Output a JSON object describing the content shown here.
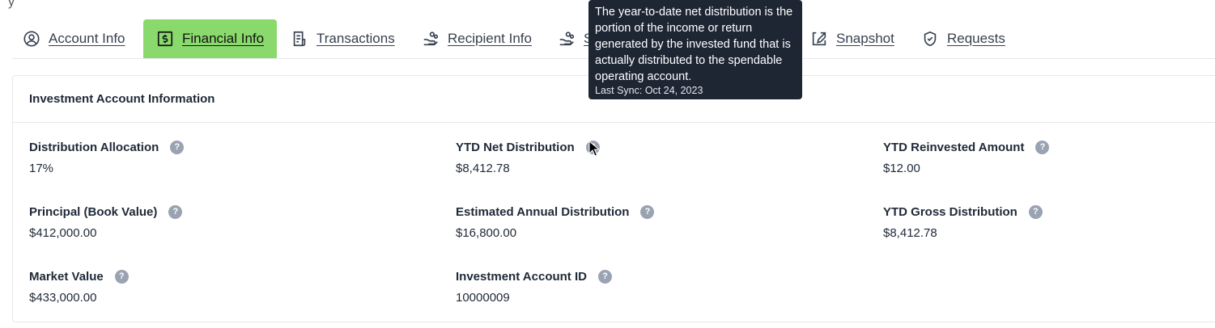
{
  "tabs": [
    {
      "label": "Account Info",
      "icon": "user-circle-icon",
      "active": false
    },
    {
      "label": "Financial Info",
      "icon": "dollar-document-icon",
      "active": true
    },
    {
      "label": "Transactions",
      "icon": "receipt-icon",
      "active": false
    },
    {
      "label": "Recipient Info",
      "icon": "hand-coins-icon",
      "active": false
    },
    {
      "label": "S",
      "icon": "hand-coins-icon",
      "active": false
    },
    {
      "label": "Snapshot",
      "icon": "edit-document-icon",
      "active": false
    },
    {
      "label": "Requests",
      "icon": "shield-check-icon",
      "active": false
    }
  ],
  "card": {
    "title": "Investment Account Information",
    "fields": [
      {
        "label": "Distribution Allocation",
        "value": "17%"
      },
      {
        "label": "YTD Net Distribution",
        "value": "$8,412.78"
      },
      {
        "label": "YTD Reinvested Amount",
        "value": "$12.00"
      },
      {
        "label": "Principal (Book Value)",
        "value": "$412,000.00"
      },
      {
        "label": "Estimated Annual Distribution",
        "value": "$16,800.00"
      },
      {
        "label": "YTD Gross Distribution",
        "value": "$8,412.78"
      },
      {
        "label": "Market Value",
        "value": "$433,000.00"
      },
      {
        "label": "Investment Account ID",
        "value": "10000009"
      }
    ]
  },
  "tooltip": {
    "text": "The year-to-date net distribution is the portion of the income or return generated by the invested fund that is actually distributed to the spendable operating account.",
    "sync": "Last Sync: Oct 24, 2023"
  },
  "help_glyph": "?",
  "colors": {
    "active_tab": "#8ad96c",
    "tooltip_bg": "#1e2533",
    "help_icon": "#9aa3b2"
  }
}
